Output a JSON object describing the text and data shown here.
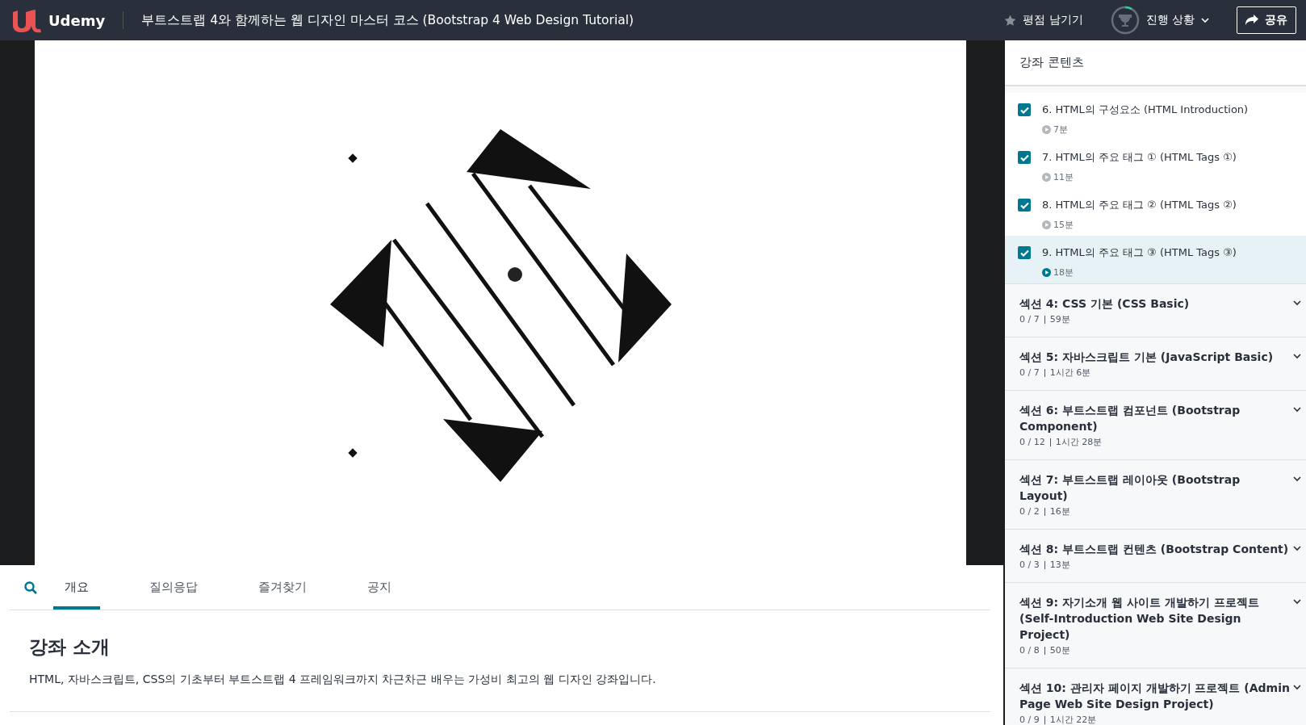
{
  "header": {
    "logo": "Udemy",
    "course_title": "부트스트랩 4와 함께하는 웹 디자인 마스터 코스 (Bootstrap 4 Web Design Tutorial)",
    "rate_button": "평점 남기기",
    "progress_button": "진행 상황",
    "share_button": "공유"
  },
  "tabs": [
    {
      "label": "개요",
      "selected": true
    },
    {
      "label": "질의응답",
      "selected": false
    },
    {
      "label": "즐겨찾기",
      "selected": false
    },
    {
      "label": "공지",
      "selected": false
    }
  ],
  "overview": {
    "heading": "강좌 소개",
    "description": "HTML, 자바스크립트, CSS의 기초부터 부트스트랩 4 프레임워크까지 차근차근 배우는 가성비 최고의 웹 디자인 강좌입니다."
  },
  "sidebar": {
    "title": "강좌 콘텐츠",
    "lectures": [
      {
        "title": "6. HTML의 구성요소 (HTML Introduction)",
        "duration": "7분",
        "checked": true,
        "selected": false
      },
      {
        "title": "7. HTML의 주요 태그 ① (HTML Tags ①)",
        "duration": "11분",
        "checked": true,
        "selected": false
      },
      {
        "title": "8. HTML의 주요 태그 ② (HTML Tags ②)",
        "duration": "15분",
        "checked": true,
        "selected": false
      },
      {
        "title": "9. HTML의 주요 태그 ③ (HTML Tags ③)",
        "duration": "18분",
        "checked": true,
        "selected": true
      }
    ],
    "sections": [
      {
        "title": "섹션 4: CSS 기본 (CSS Basic)",
        "count": "0 / 7",
        "duration": "59분"
      },
      {
        "title": "섹션 5: 자바스크립트 기본 (JavaScript Basic)",
        "count": "0 / 7",
        "duration": "1시간 6분"
      },
      {
        "title": "섹션 6: 부트스트랩 컴포넌트 (Bootstrap Component)",
        "count": "0 / 12",
        "duration": "1시간 28분"
      },
      {
        "title": "섹션 7: 부트스트랩 레이아웃 (Bootstrap Layout)",
        "count": "0 / 2",
        "duration": "16분"
      },
      {
        "title": "섹션 8: 부트스트랩 컨텐츠 (Bootstrap Content)",
        "count": "0 / 3",
        "duration": "13분"
      },
      {
        "title": "섹션 9: 자기소개 웹 사이트 개발하기 프로젝트 (Self-Introduction Web Site Design Project)",
        "count": "0 / 8",
        "duration": "50분"
      },
      {
        "title": "섹션 10: 관리자 페이지 개발하기 프로젝트 (Admin Page Web Site Design Project)",
        "count": "0 / 9",
        "duration": "1시간 22분"
      }
    ]
  }
}
